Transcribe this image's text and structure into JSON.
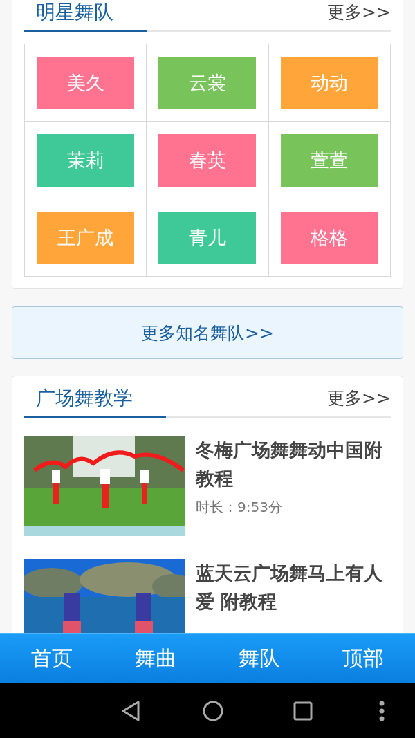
{
  "star_teams": {
    "title": "明星舞队",
    "more": "更多>>",
    "teams": [
      {
        "name": "美久",
        "color": "#ff7391"
      },
      {
        "name": "云裳",
        "color": "#78c35a"
      },
      {
        "name": "动动",
        "color": "#ffa53a"
      },
      {
        "name": "茉莉",
        "color": "#3fc898"
      },
      {
        "name": "春英",
        "color": "#ff7391"
      },
      {
        "name": "萱萱",
        "color": "#78c35a"
      },
      {
        "name": "王广成",
        "color": "#ffa53a"
      },
      {
        "name": "青儿",
        "color": "#3fc898"
      },
      {
        "name": "格格",
        "color": "#ff7391"
      }
    ]
  },
  "more_teams_button": "更多知名舞队>>",
  "tutorials": {
    "title": "广场舞教学",
    "more": "更多>>",
    "videos": [
      {
        "title": "冬梅广场舞舞动中国附教程",
        "duration": "时长：9:53分",
        "kind": "ribbon"
      },
      {
        "title": "蓝天云广场舞马上有人爱 附教程",
        "kind": "lake"
      }
    ]
  },
  "bottom_nav": [
    "首页",
    "舞曲",
    "舞队",
    "顶部"
  ]
}
